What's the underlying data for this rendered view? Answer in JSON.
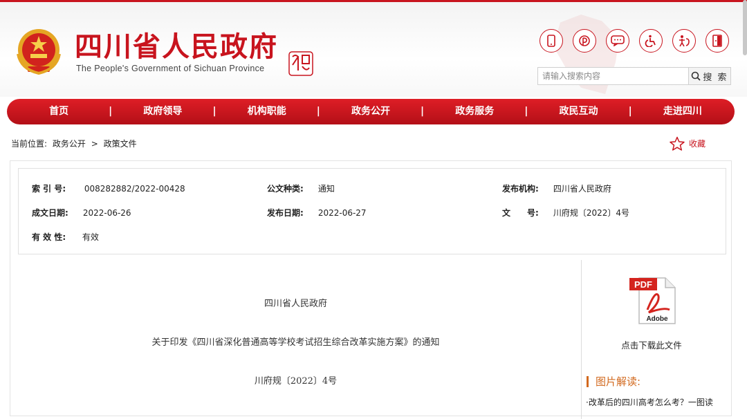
{
  "header": {
    "title": "四川省人民政府",
    "subtitle": "The People's Government of Sichuan Province",
    "icons": [
      "mobile-icon",
      "weibo-icon",
      "message-icon",
      "accessibility-icon",
      "elderly-care-icon",
      "exit-icon"
    ]
  },
  "search": {
    "placeholder": "请输入搜索内容",
    "button_label": "搜 索"
  },
  "nav": {
    "items": [
      "首页",
      "政府领导",
      "机构职能",
      "政务公开",
      "政务服务",
      "政民互动",
      "走进四川"
    ]
  },
  "breadcrumb": {
    "prefix": "当前位置:",
    "items": [
      "政务公开",
      "政策文件"
    ],
    "separator": ">"
  },
  "collect_label": "收藏",
  "meta": {
    "index_label": "索 引 号:",
    "index_value": "008282882/2022-00428",
    "doc_type_label": "公文种类:",
    "doc_type_value": "通知",
    "publisher_label": "发布机构:",
    "publisher_value": "四川省人民政府",
    "written_date_label": "成文日期:",
    "written_date_value": "2022-06-26",
    "publish_date_label": "发布日期:",
    "publish_date_value": "2022-06-27",
    "doc_no_label": "文　　号:",
    "doc_no_value": "川府规〔2022〕4号",
    "validity_label": "有 效 性:",
    "validity_value": "有效"
  },
  "document": {
    "issuer": "四川省人民政府",
    "title": "关于印发《四川省深化普通高等学校考试招生综合改革实施方案》的通知",
    "number": "川府规〔2022〕4号"
  },
  "sidebar": {
    "download_label": "点击下载此文件",
    "pic_title": "图片解读:",
    "pic_item": "·改革后的四川高考怎么考？一图读"
  },
  "colors": {
    "brand_red": "#c8141e",
    "accent_orange": "#d2691e"
  }
}
